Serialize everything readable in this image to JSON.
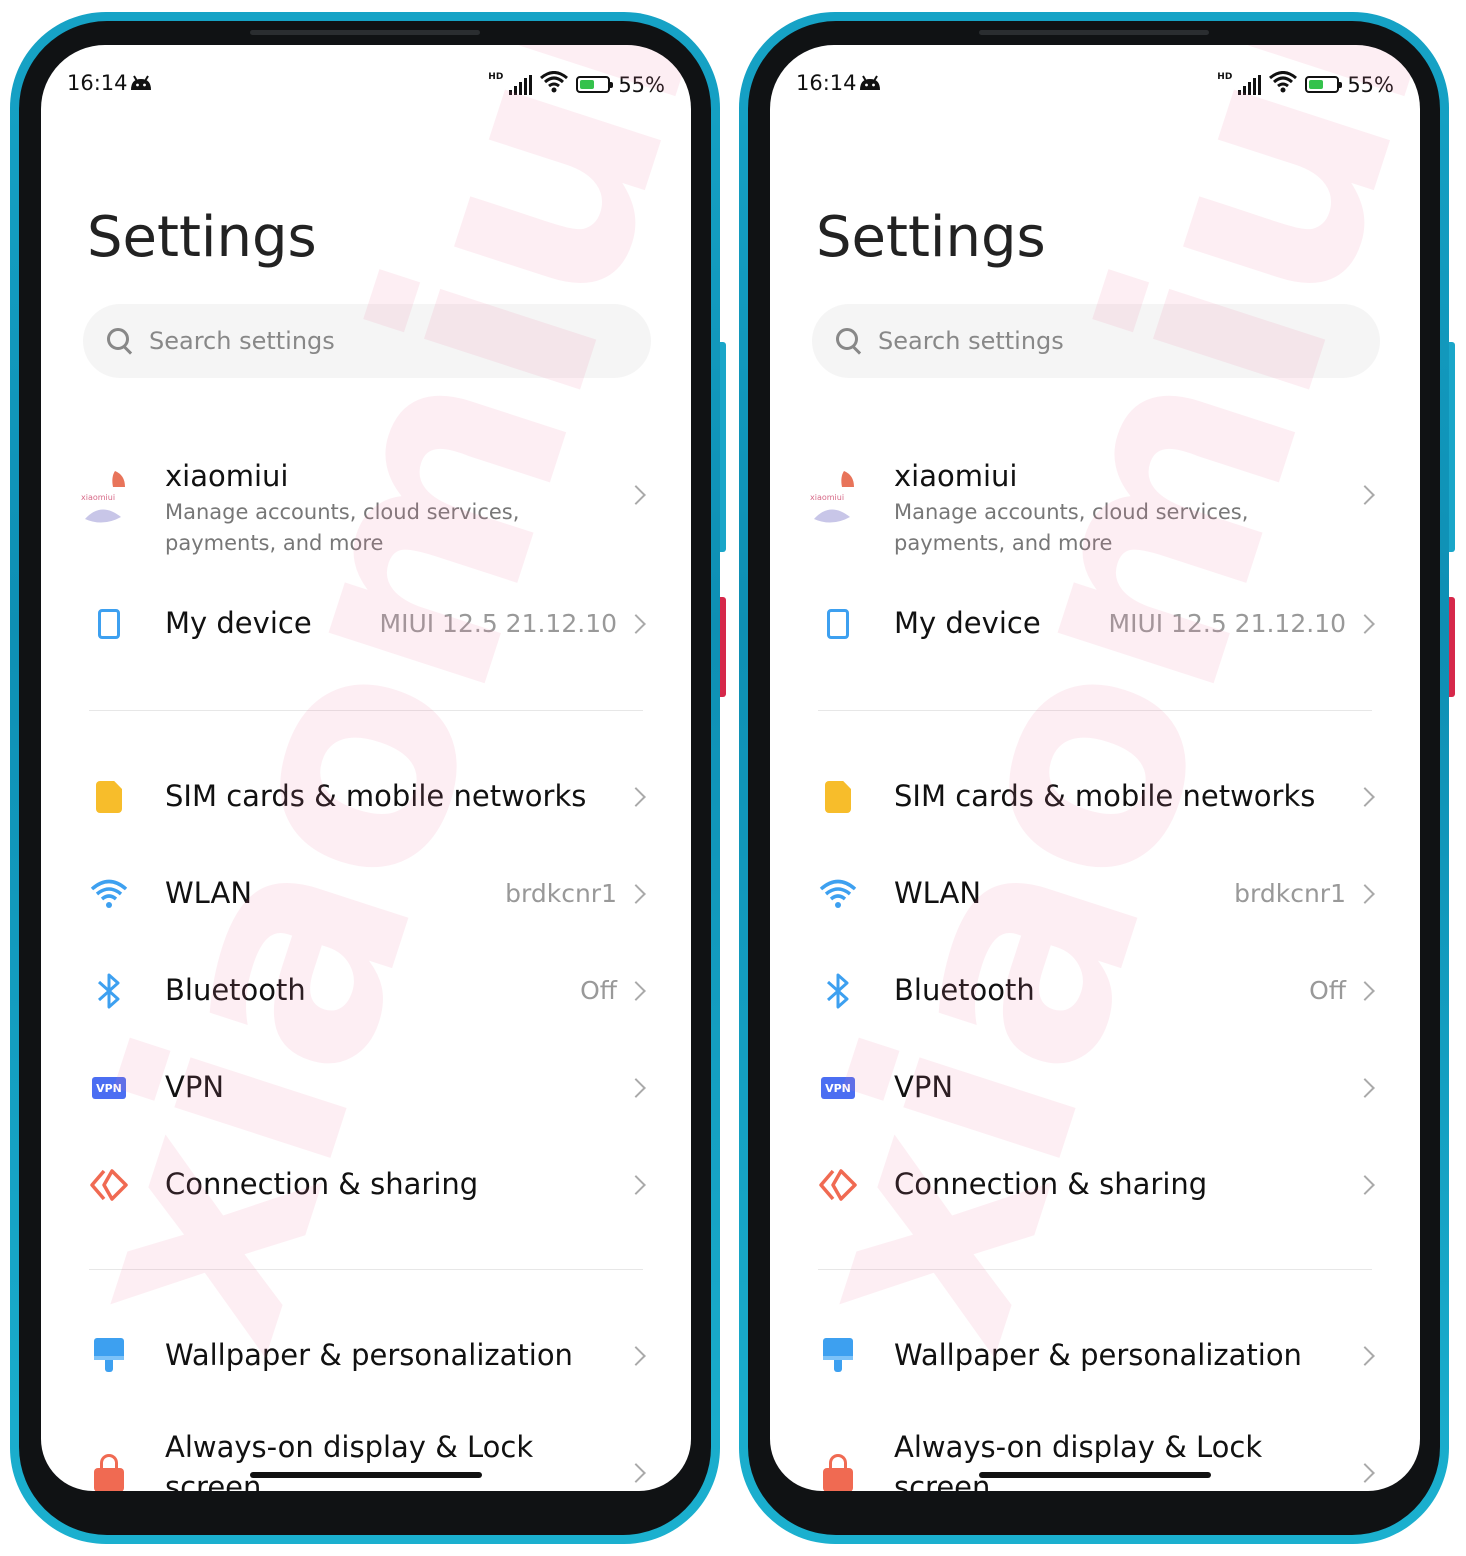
{
  "phones": [
    {
      "status": {
        "time": "16:14",
        "network": "HD",
        "battery": "55%",
        "battery_level": 0.55
      },
      "page_title": "Settings",
      "search": {
        "placeholder": "Search settings"
      },
      "account": {
        "name": "xiaomiui",
        "description": "Manage accounts, cloud services, payments, and more",
        "avatar_text": "xiaomiui"
      },
      "my_device": {
        "label": "My device",
        "value": "MIUI 12.5 21.12.10"
      },
      "sim": {
        "label": "SIM cards & mobile networks"
      },
      "wlan": {
        "label": "WLAN",
        "value": "brdkcnr1"
      },
      "bluetooth": {
        "label": "Bluetooth",
        "value": "Off"
      },
      "vpn": {
        "label": "VPN",
        "icon_text": "VPN"
      },
      "connection": {
        "label": "Connection & sharing"
      },
      "wallpaper": {
        "label": "Wallpaper & personalization"
      },
      "lockscreen": {
        "label": "Always-on display & Lock screen"
      },
      "watermark": "xiaomiui"
    },
    {
      "status": {
        "time": "16:14",
        "network": "HD",
        "battery": "55%",
        "battery_level": 0.55
      },
      "page_title": "Settings",
      "search": {
        "placeholder": "Search settings"
      },
      "account": {
        "name": "xiaomiui",
        "description": "Manage accounts, cloud services, payments, and more",
        "avatar_text": "xiaomiui"
      },
      "my_device": {
        "label": "My device",
        "value": "MIUI 12.5 21.12.10"
      },
      "sim": {
        "label": "SIM cards & mobile networks"
      },
      "wlan": {
        "label": "WLAN",
        "value": "brdkcnr1"
      },
      "bluetooth": {
        "label": "Bluetooth",
        "value": "Off"
      },
      "vpn": {
        "label": "VPN",
        "icon_text": "VPN"
      },
      "connection": {
        "label": "Connection & sharing"
      },
      "wallpaper": {
        "label": "Wallpaper & personalization"
      },
      "lockscreen": {
        "label": "Always-on display & Lock screen"
      },
      "watermark": "xiaomiui"
    }
  ],
  "colors": {
    "frame": "#16a3c6",
    "accent_blue": "#3da0f0",
    "sim_yellow": "#f7bd2b",
    "vpn_blue": "#4b6ef2",
    "connection_orange": "#f06a52",
    "watermark_pink": "#ee78a5"
  },
  "icons": [
    "android-icon",
    "signal-icon",
    "wifi-icon",
    "battery-icon",
    "search-icon",
    "avatar-icon",
    "phone-icon",
    "sim-icon",
    "wifi-icon",
    "bluetooth-icon",
    "vpn-icon",
    "connection-icon",
    "wallpaper-icon",
    "lock-icon",
    "chevron-right-icon"
  ]
}
